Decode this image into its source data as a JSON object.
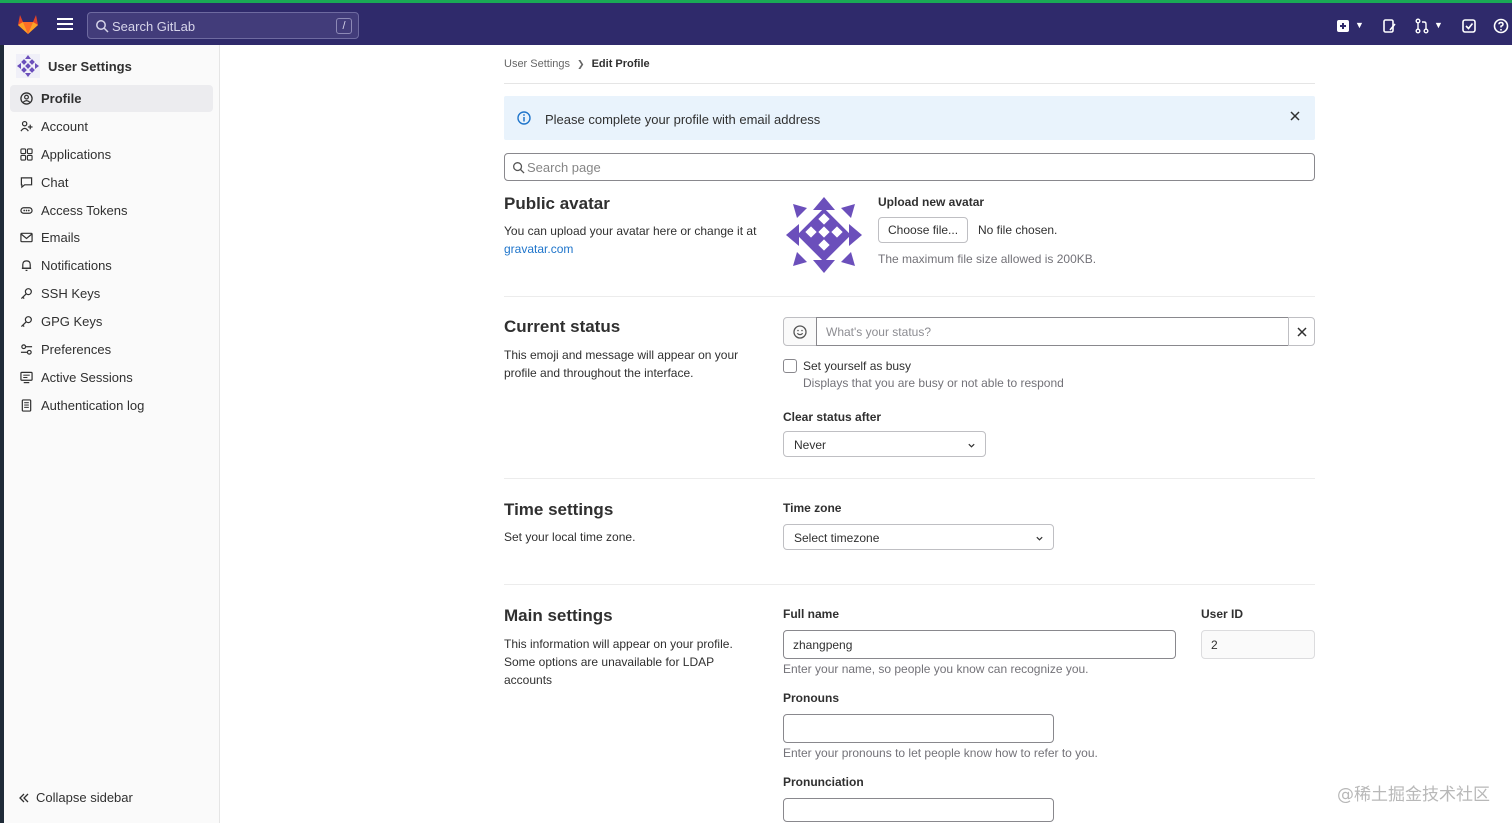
{
  "topbar": {
    "search_placeholder": "Search GitLab",
    "search_shortcut": "/",
    "icons": [
      "tanuki-logo-icon",
      "hamburger-icon",
      "search-icon",
      "create-new-icon",
      "issues-icon",
      "merge-requests-icon",
      "todo-icon",
      "help-icon"
    ]
  },
  "sidebar": {
    "title": "User Settings",
    "items": [
      {
        "label": "Profile",
        "icon": "profile-icon",
        "active": true
      },
      {
        "label": "Account",
        "icon": "account-icon",
        "active": false
      },
      {
        "label": "Applications",
        "icon": "applications-icon",
        "active": false
      },
      {
        "label": "Chat",
        "icon": "chat-icon",
        "active": false
      },
      {
        "label": "Access Tokens",
        "icon": "token-icon",
        "active": false
      },
      {
        "label": "Emails",
        "icon": "mail-icon",
        "active": false
      },
      {
        "label": "Notifications",
        "icon": "bell-icon",
        "active": false
      },
      {
        "label": "SSH Keys",
        "icon": "key-icon",
        "active": false
      },
      {
        "label": "GPG Keys",
        "icon": "key-icon",
        "active": false
      },
      {
        "label": "Preferences",
        "icon": "preferences-icon",
        "active": false
      },
      {
        "label": "Active Sessions",
        "icon": "monitor-icon",
        "active": false
      },
      {
        "label": "Authentication log",
        "icon": "log-icon",
        "active": false
      }
    ],
    "collapse_label": "Collapse sidebar"
  },
  "breadcrumb": {
    "parent": "User Settings",
    "current": "Edit Profile"
  },
  "alert": {
    "message": "Please complete your profile with email address"
  },
  "page_search": {
    "placeholder": "Search page"
  },
  "avatar_section": {
    "title": "Public avatar",
    "desc_prefix": "You can upload your avatar here or change it at ",
    "desc_link": "gravatar.com",
    "upload_label": "Upload new avatar",
    "choose_button": "Choose file...",
    "no_file": "No file chosen.",
    "max_size": "The maximum file size allowed is 200KB."
  },
  "status_section": {
    "title": "Current status",
    "desc": "This emoji and message will appear on your profile and throughout the interface.",
    "placeholder": "What's your status?",
    "busy_label": "Set yourself as busy",
    "busy_help": "Displays that you are busy or not able to respond",
    "clear_after_label": "Clear status after",
    "clear_after_value": "Never"
  },
  "time_section": {
    "title": "Time settings",
    "desc": "Set your local time zone.",
    "timezone_label": "Time zone",
    "timezone_value": "Select timezone"
  },
  "main_section": {
    "title": "Main settings",
    "desc": "This information will appear on your profile. Some options are unavailable for LDAP accounts",
    "full_name_label": "Full name",
    "full_name_value": "zhangpeng",
    "full_name_help": "Enter your name, so people you know can recognize you.",
    "user_id_label": "User ID",
    "user_id_value": "2",
    "pronouns_label": "Pronouns",
    "pronouns_value": "",
    "pronouns_help": "Enter your pronouns to let people know how to refer to you.",
    "pronunciation_label": "Pronunciation",
    "pronunciation_value": ""
  },
  "watermark": "@稀土掘金技术社区",
  "colors": {
    "topbar": "#2f2a6b",
    "link": "#1f75cb",
    "alert_bg": "#e9f3fc",
    "avatar": "#6b4fbb"
  }
}
